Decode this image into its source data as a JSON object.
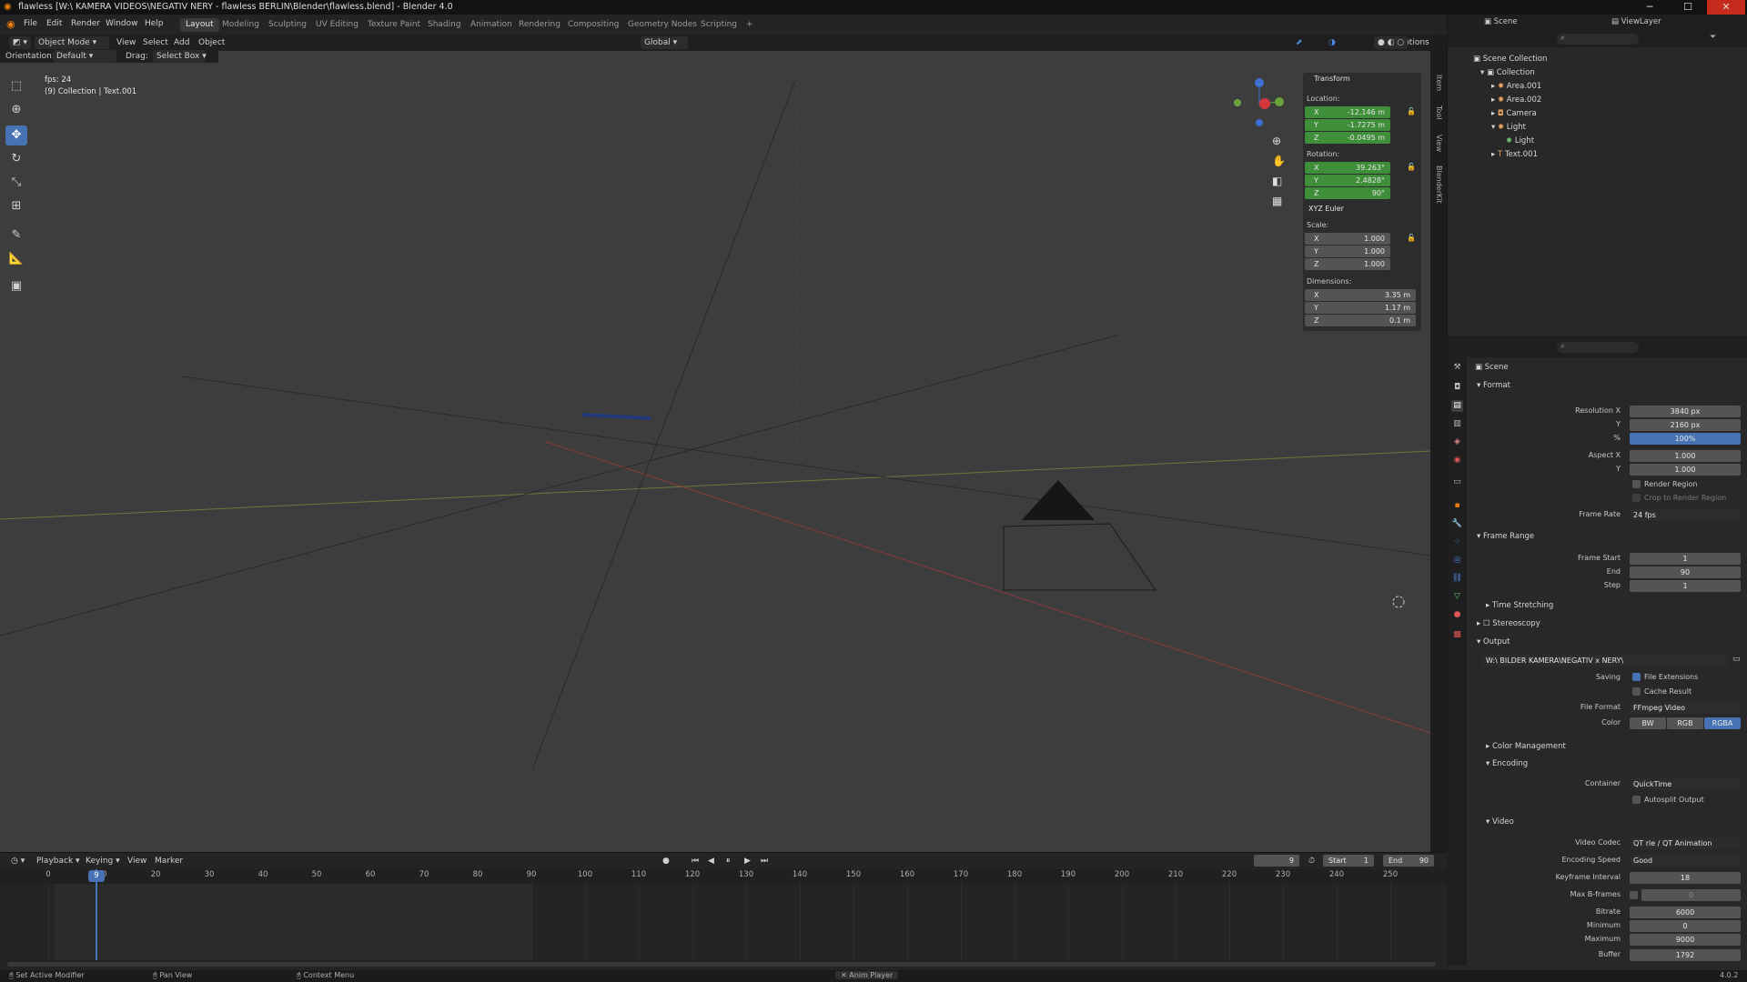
{
  "window": {
    "title": "flawless [W:\\ KAMERA VIDEOS\\NEGATIV NERY - flawless BERLIN\\Blender\\flawless.blend] - Blender 4.0",
    "minimize": "─",
    "maximize": "☐",
    "close": "✕"
  },
  "menu": [
    "File",
    "Edit",
    "Render",
    "Window",
    "Help"
  ],
  "workspaces": [
    "Layout",
    "Modeling",
    "Sculpting",
    "UV Editing",
    "Texture Paint",
    "Shading",
    "Animation",
    "Rendering",
    "Compositing",
    "Geometry Nodes",
    "Scripting",
    "+"
  ],
  "header3d": {
    "mode": "Object Mode",
    "view": "View",
    "select": "Select",
    "add": "Add",
    "object": "Object",
    "orientation_label": "Orientation:",
    "orientation": "Default",
    "drag_label": "Drag:",
    "drag": "Select Box",
    "transform_orientation": "Global",
    "options": "Options"
  },
  "viewport": {
    "fps": "fps: 24",
    "info": "(9) Collection | Text.001"
  },
  "npanel": {
    "title": "Transform",
    "location_label": "Location:",
    "location": [
      "-12.146 m",
      "-1.7275 m",
      "-0.0495 m"
    ],
    "rotation_label": "Rotation:",
    "rotation": [
      "39.263°",
      "2.4828°",
      "90°"
    ],
    "rotation_mode": "XYZ Euler",
    "scale_label": "Scale:",
    "scale": [
      "1.000",
      "1.000",
      "1.000"
    ],
    "dimensions_label": "Dimensions:",
    "dimensions": [
      "3.35 m",
      "1.17 m",
      "0.1 m"
    ],
    "axes": [
      "X",
      "Y",
      "Z"
    ],
    "tabs": [
      "Item",
      "Tool",
      "View",
      "BlenderKit"
    ]
  },
  "outliner": {
    "scene": "Scene",
    "viewlayer": "ViewLayer",
    "items": [
      {
        "label": "Scene Collection"
      },
      {
        "label": "Collection"
      },
      {
        "label": "Area.001"
      },
      {
        "label": "Area.002"
      },
      {
        "label": "Camera"
      },
      {
        "label": "Light"
      },
      {
        "label": "Light"
      },
      {
        "label": "Text.001"
      }
    ]
  },
  "properties": {
    "breadcrumb": "Scene",
    "format": {
      "title": "Format",
      "resolution_x_label": "Resolution X",
      "resolution_x": "3840 px",
      "y_label": "Y",
      "resolution_y": "2160 px",
      "pct_label": "%",
      "percent": "100%",
      "aspect_x_label": "Aspect X",
      "aspect_x": "1.000",
      "aspect_y": "1.000",
      "render_region": "Render Region",
      "crop": "Crop to Render Region",
      "frame_rate_label": "Frame Rate",
      "frame_rate": "24 fps"
    },
    "frame_range": {
      "title": "Frame Range",
      "start_label": "Frame Start",
      "start": "1",
      "end_label": "End",
      "end": "90",
      "step_label": "Step",
      "step": "1"
    },
    "time_stretching": "Time Stretching",
    "stereoscopy": "Stereoscopy",
    "output": {
      "title": "Output",
      "path": "W:\\ BILDER KAMERA\\NEGATIV x NERY\\",
      "saving_label": "Saving",
      "file_ext": "File Extensions",
      "cache": "Cache Result",
      "file_format_label": "File Format",
      "file_format": "FFmpeg Video",
      "color_label": "Color",
      "color_opts": [
        "BW",
        "RGB",
        "RGBA"
      ]
    },
    "color_management": "Color Management",
    "encoding": {
      "title": "Encoding",
      "container_label": "Container",
      "container": "QuickTime",
      "autosplit": "Autosplit Output"
    },
    "video": {
      "title": "Video",
      "codec_label": "Video Codec",
      "codec": "QT rle / QT Animation",
      "speed_label": "Encoding Speed",
      "speed": "Good",
      "keyframe_label": "Keyframe Interval",
      "keyframe": "18",
      "bframes_label": "Max B-frames",
      "bframes": "0",
      "bitrate_label": "Bitrate",
      "bitrate": "6000",
      "min_label": "Minimum",
      "min": "0",
      "max_label": "Maximum",
      "max": "9000",
      "buffer_label": "Buffer",
      "buffer": "1792"
    }
  },
  "timeline": {
    "menus": [
      "Playback",
      "Keying",
      "View",
      "Marker"
    ],
    "current": "9",
    "start_label": "Start",
    "start": "1",
    "end_label": "End",
    "end": "90",
    "ticks": [
      "0",
      "10",
      "20",
      "30",
      "40",
      "50",
      "60",
      "70",
      "80",
      "90",
      "100",
      "110",
      "120",
      "130",
      "140",
      "150",
      "160",
      "170",
      "180",
      "190",
      "200",
      "210",
      "220",
      "230",
      "240",
      "250"
    ]
  },
  "status": {
    "left": "Set Active Modifier",
    "mid": "Pan View",
    "ctx": "Context Menu",
    "player": "Anim Player",
    "version": "4.0.2"
  }
}
